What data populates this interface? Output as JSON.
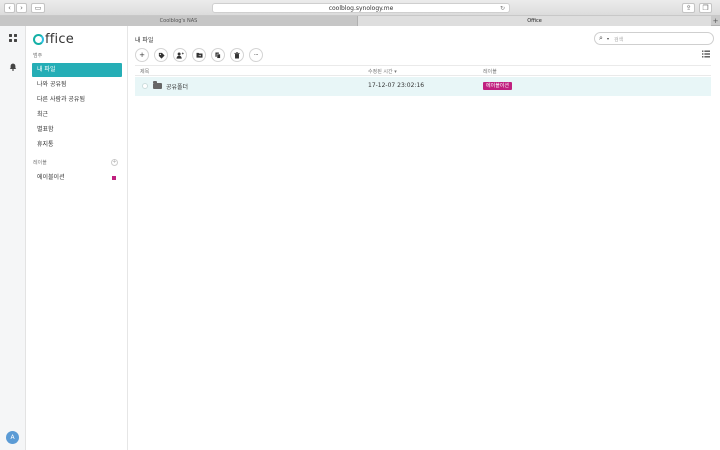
{
  "browser": {
    "url": "coolblog.synology.me",
    "tabs": [
      {
        "label": "Coolblog's NAS",
        "active": false
      },
      {
        "label": "Office",
        "active": true
      }
    ]
  },
  "rail": {
    "avatar_letter": "A",
    "icons": [
      "apps-grid-icon",
      "bell-icon"
    ]
  },
  "sidebar": {
    "logo_text": "ffice",
    "category_label": "범주",
    "items": [
      {
        "label": "내 파일",
        "selected": true
      },
      {
        "label": "나와 공유됨",
        "selected": false
      },
      {
        "label": "다른 사람과 공유됨",
        "selected": false
      },
      {
        "label": "최근",
        "selected": false
      },
      {
        "label": "별표함",
        "selected": false
      },
      {
        "label": "휴지통",
        "selected": false
      }
    ],
    "labels_header": "레이블",
    "labels": [
      {
        "label": "에이블이션",
        "color": "#c0207f"
      }
    ]
  },
  "main": {
    "title": "내 파일",
    "search_placeholder": "검색",
    "toolbar": [
      "plus-icon",
      "tag-icon",
      "share-user-icon",
      "move-folder-icon",
      "copy-icon",
      "trash-icon",
      "more-icon"
    ],
    "columns": {
      "name": "제목",
      "modified": "수정된 시간",
      "label": "레이블"
    },
    "rows": [
      {
        "name": "공유폴더",
        "modified": "17-12-07 23:02:16",
        "tag": "에이블이션"
      }
    ]
  },
  "colors": {
    "accent": "#25aeb6",
    "label_tag": "#c0207f",
    "row_highlight": "#e8f6f7"
  }
}
